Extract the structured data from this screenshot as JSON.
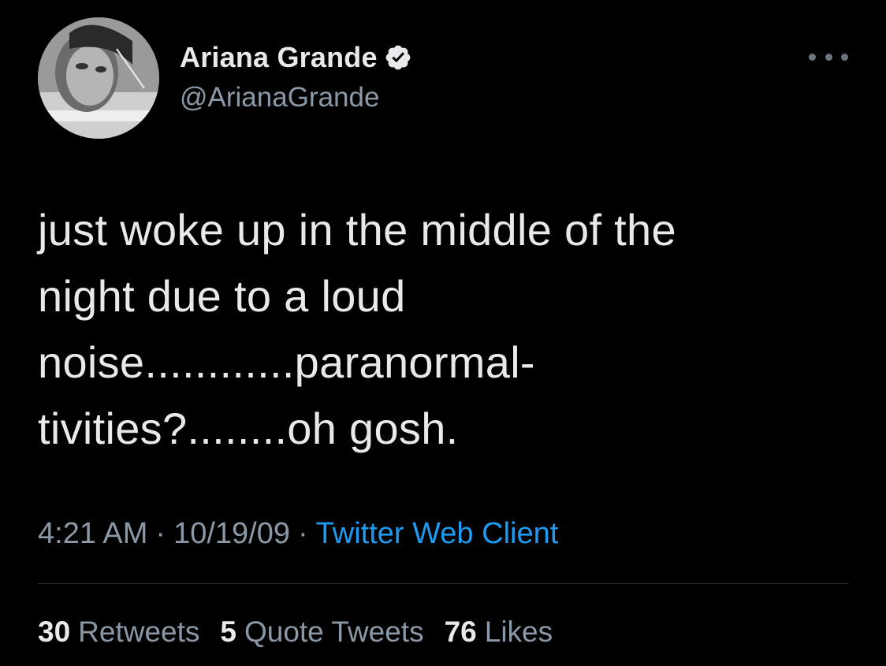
{
  "author": {
    "display_name": "Ariana Grande",
    "handle": "@ArianaGrande",
    "verified": true
  },
  "tweet": {
    "text": "just woke up in the middle of the\nnight due to a loud\nnoise............paranormal-\ntivities?........oh gosh."
  },
  "meta": {
    "time": "4:21 AM",
    "separator": "·",
    "date": "10/19/09",
    "source": "Twitter Web Client"
  },
  "stats": {
    "retweets_count": "30",
    "retweets_label": "Retweets",
    "quote_tweets_count": "5",
    "quote_tweets_label": "Quote Tweets",
    "likes_count": "76",
    "likes_label": "Likes"
  },
  "icons": {
    "verified": "verified-badge-icon",
    "more": "more-options-icon"
  },
  "colors": {
    "background": "#000000",
    "text_primary": "#e7e9ea",
    "text_secondary": "#8b98a5",
    "link": "#1d9bf0",
    "divider": "#2f3336"
  }
}
